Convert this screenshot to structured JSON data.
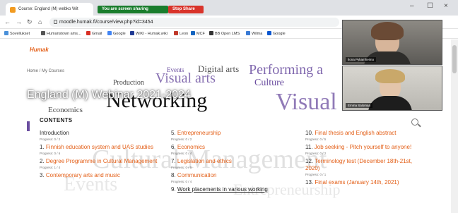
{
  "browser": {
    "tab_title": "Course: England (M) webko Wit",
    "sharing_label": "You are screen sharing",
    "stop_label": "Stop Share",
    "url": "moodle.humak.fi/course/view.php?id=3454",
    "bookmarks": [
      "Sovellukset",
      "Humanstown ams...",
      "Gmail",
      "Google",
      "WIKI - Humak.wiki",
      "Leon",
      "MCF",
      "BB Open LMS",
      "Wilma",
      "Google"
    ]
  },
  "page": {
    "breadcrumb": "Home / My Courses",
    "course_title": "England (M) Webinar 2021-2024",
    "contents_title": "CONTENTS",
    "intro": {
      "label": "Introduction",
      "progress": "Progress: 0 / 2"
    },
    "columns": [
      [
        {
          "num": "1.",
          "label": "Finnish education system and UAS studies",
          "progress": "Progress: 0 / 6"
        },
        {
          "num": "2.",
          "label": "Degree Programme in Cultural Management",
          "progress": "Progress: 1 / 4"
        },
        {
          "num": "3.",
          "label": "Contemporary arts and music"
        }
      ],
      [
        {
          "num": "5.",
          "label": "Entrepreneurship",
          "progress": "Progress: 0 / 2"
        },
        {
          "num": "6.",
          "label": "Economics",
          "progress": "Progress: 0 / 4"
        },
        {
          "num": "7.",
          "label": "Legislation and ethics",
          "progress": "Progress: 0 / 5"
        },
        {
          "num": "8.",
          "label": "Communication",
          "progress": "Progress: 0 / 4"
        },
        {
          "num": "9.",
          "label": "Work placements in various working"
        }
      ],
      [
        {
          "num": "10.",
          "label": "Final thesis and English abstract",
          "progress": "Progress: 0 / 5"
        },
        {
          "num": "11.",
          "label": "Job seeking - Pitch yourself to anyone!",
          "progress": "Progress: 0 / 2"
        },
        {
          "num": "12.",
          "label": "Terminology test (December 18th-21st, 2020)",
          "progress": "Progress: 0 / 1"
        },
        {
          "num": "13.",
          "label": "Final exams (January 14th, 2021)"
        }
      ]
    ]
  },
  "video": {
    "participant1": "Ilona Pykamheimo",
    "participant2": "Emma Salomaa"
  },
  "colors": {
    "accent": "#e35e16",
    "cloud_purple": "#6b4ea0"
  }
}
